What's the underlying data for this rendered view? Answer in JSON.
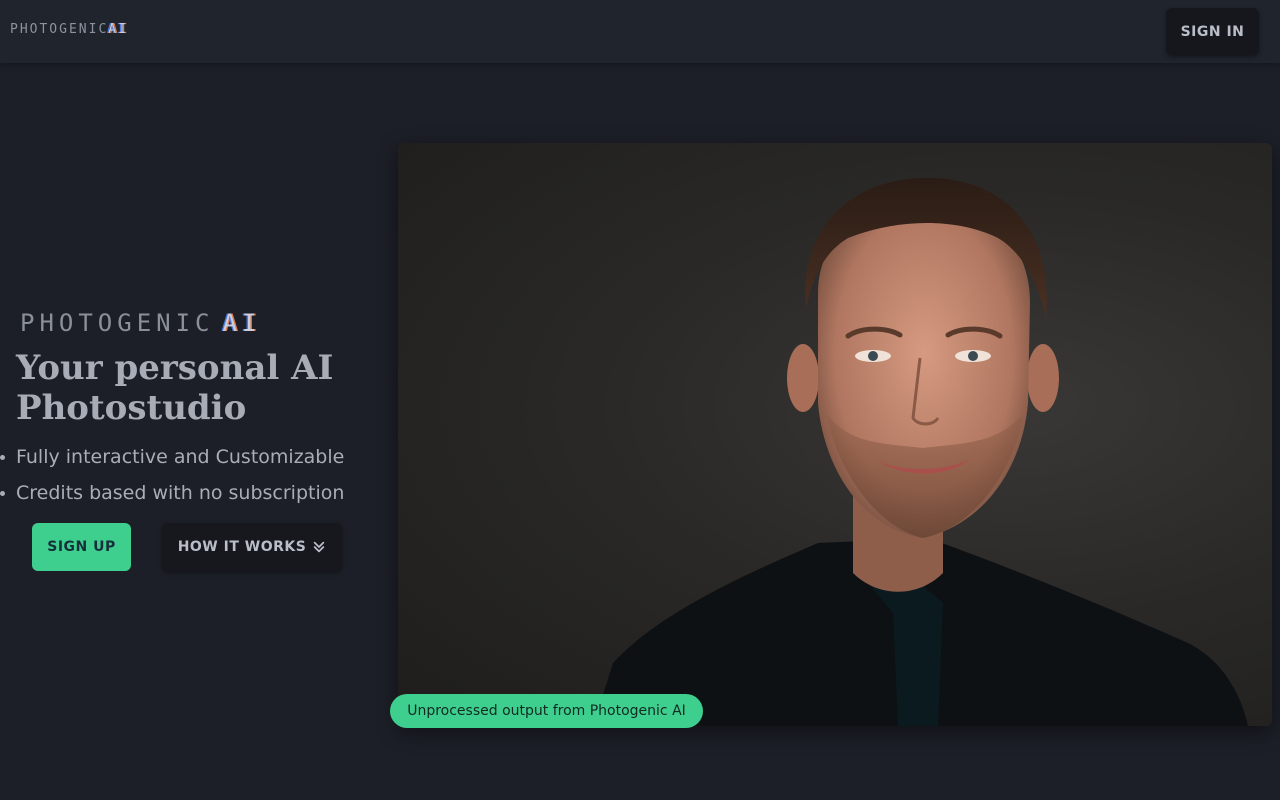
{
  "header": {
    "logo_text": "PHOTOGENIC",
    "logo_ai": "AI",
    "signin_label": "SIGN IN"
  },
  "hero": {
    "logo_text": "PHOTOGENIC",
    "logo_ai": "AI",
    "title": "Your personal AI Photostudio",
    "features": [
      "Fully interactive and Customizable",
      "Credits based with no subscription"
    ],
    "signup_label": "SIGN UP",
    "how_it_works_label": "HOW IT WORKS",
    "how_it_works_icon": "chevron-double-down-icon"
  },
  "showcase": {
    "caption": "Unprocessed output from Photogenic AI"
  },
  "colors": {
    "accent": "#3ecf8e",
    "background": "#1c1f27",
    "navbar": "#20242d"
  }
}
